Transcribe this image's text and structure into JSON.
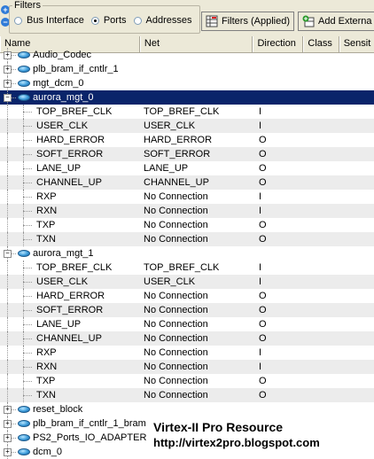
{
  "filters": {
    "legend": "Filters",
    "options": [
      {
        "label": "Bus Interface",
        "checked": false
      },
      {
        "label": "Ports",
        "checked": true
      },
      {
        "label": "Addresses",
        "checked": false
      }
    ]
  },
  "toolbar": {
    "filters_applied_label": "Filters (Applied)",
    "add_external_label": "Add Externa"
  },
  "columns": [
    "Name",
    "Net",
    "Direction",
    "Class",
    "Sensit"
  ],
  "rows": [
    {
      "type": "component",
      "name": "Audio_Codec",
      "expanded": false
    },
    {
      "type": "component",
      "name": "plb_bram_if_cntlr_1",
      "expanded": false
    },
    {
      "type": "component",
      "name": "mgt_dcm_0",
      "expanded": false
    },
    {
      "type": "component",
      "name": "aurora_mgt_0",
      "expanded": true,
      "selected": true
    },
    {
      "type": "port",
      "name": "TOP_BREF_CLK",
      "net": "TOP_BREF_CLK",
      "dir": "I"
    },
    {
      "type": "port",
      "name": "USER_CLK",
      "net": "USER_CLK",
      "dir": "I"
    },
    {
      "type": "port",
      "name": "HARD_ERROR",
      "net": "HARD_ERROR",
      "dir": "O"
    },
    {
      "type": "port",
      "name": "SOFT_ERROR",
      "net": "SOFT_ERROR",
      "dir": "O"
    },
    {
      "type": "port",
      "name": "LANE_UP",
      "net": "LANE_UP",
      "dir": "O"
    },
    {
      "type": "port",
      "name": "CHANNEL_UP",
      "net": "CHANNEL_UP",
      "dir": "O"
    },
    {
      "type": "port",
      "name": "RXP",
      "net": "No Connection",
      "dir": "I"
    },
    {
      "type": "port",
      "name": "RXN",
      "net": "No Connection",
      "dir": "I"
    },
    {
      "type": "port",
      "name": "TXP",
      "net": "No Connection",
      "dir": "O"
    },
    {
      "type": "port",
      "name": "TXN",
      "net": "No Connection",
      "dir": "O"
    },
    {
      "type": "component",
      "name": "aurora_mgt_1",
      "expanded": true
    },
    {
      "type": "port",
      "name": "TOP_BREF_CLK",
      "net": "TOP_BREF_CLK",
      "dir": "I"
    },
    {
      "type": "port",
      "name": "USER_CLK",
      "net": "USER_CLK",
      "dir": "I"
    },
    {
      "type": "port",
      "name": "HARD_ERROR",
      "net": "No Connection",
      "dir": "O"
    },
    {
      "type": "port",
      "name": "SOFT_ERROR",
      "net": "No Connection",
      "dir": "O"
    },
    {
      "type": "port",
      "name": "LANE_UP",
      "net": "No Connection",
      "dir": "O"
    },
    {
      "type": "port",
      "name": "CHANNEL_UP",
      "net": "No Connection",
      "dir": "O"
    },
    {
      "type": "port",
      "name": "RXP",
      "net": "No Connection",
      "dir": "I"
    },
    {
      "type": "port",
      "name": "RXN",
      "net": "No Connection",
      "dir": "I"
    },
    {
      "type": "port",
      "name": "TXP",
      "net": "No Connection",
      "dir": "O"
    },
    {
      "type": "port",
      "name": "TXN",
      "net": "No Connection",
      "dir": "O"
    },
    {
      "type": "component",
      "name": "reset_block",
      "expanded": false
    },
    {
      "type": "component",
      "name": "plb_bram_if_cntlr_1_bram",
      "expanded": false
    },
    {
      "type": "component",
      "name": "PS2_Ports_IO_ADAPTER",
      "expanded": false
    },
    {
      "type": "component",
      "name": "dcm_0",
      "expanded": false
    }
  ],
  "watermark": {
    "title": "Virtex-II Pro Resource",
    "url": "http://virtex2pro.blogspot.com"
  },
  "colors": {
    "selected_bg": "#0a246a",
    "alt_row_bg": "#ececec",
    "chrome_bg": "#ece9d8"
  }
}
